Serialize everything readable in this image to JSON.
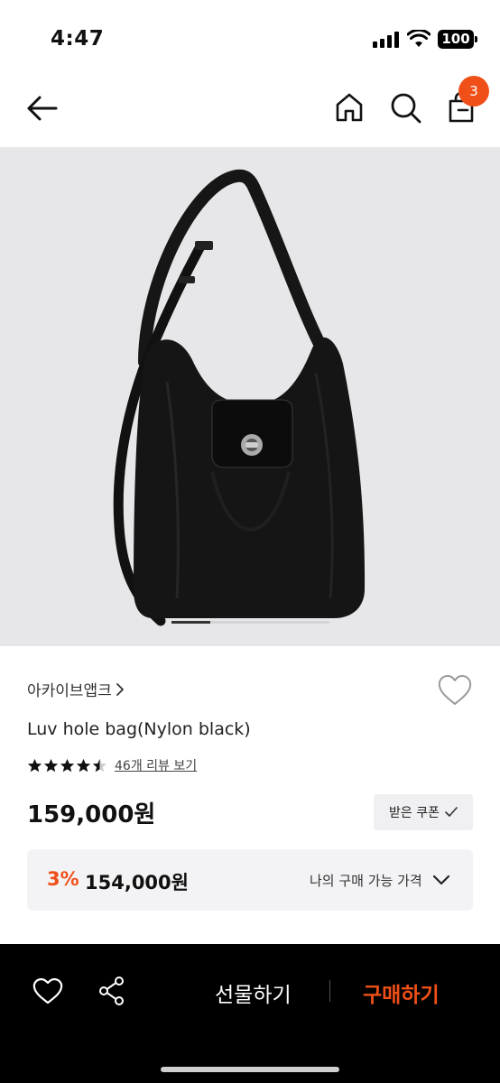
{
  "status_bar": {
    "time": "4:47",
    "battery": "100"
  },
  "header": {
    "cart_count": "3"
  },
  "product": {
    "brand": "아카이브앱크",
    "name": "Luv hole bag(Nylon black)",
    "rating_stars": 4.5,
    "review_link": "46개 리뷰 보기",
    "price": "159,000원",
    "coupon_button": "받은 쿠폰",
    "image_position": "1 of 4"
  },
  "my_price": {
    "discount_rate": "3%",
    "price": "154,000원",
    "label": "나의 구매 가능 가격"
  },
  "bottom_bar": {
    "gift_label": "선물하기",
    "buy_label": "구매하기"
  },
  "colors": {
    "accent": "#f04f18",
    "bottom_bar_bg": "#000000",
    "image_bg": "#e7e7e9"
  },
  "icons": [
    "back-arrow-icon",
    "home-icon",
    "search-icon",
    "shopping-bag-icon",
    "heart-icon",
    "share-icon",
    "chevron-down-icon",
    "check-icon",
    "star-icon"
  ]
}
